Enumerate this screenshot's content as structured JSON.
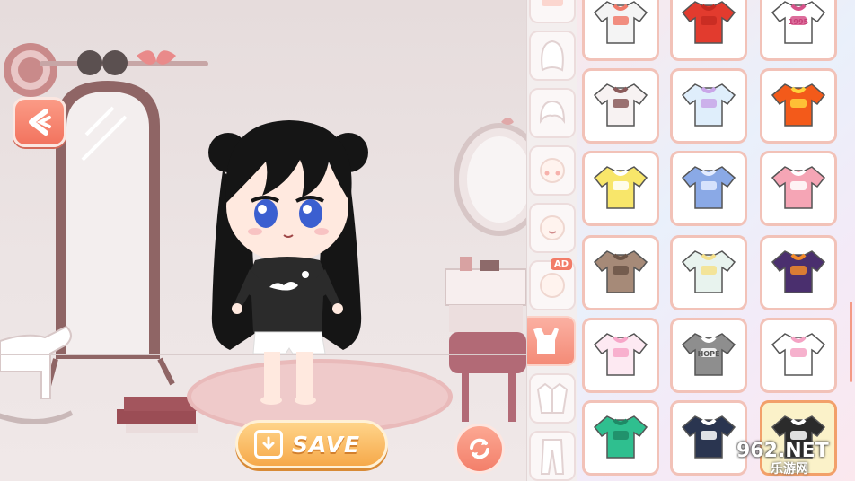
{
  "scene": {
    "save_label": "SAVE",
    "icons": {
      "back": "back-arrow-icon",
      "save": "save-download-icon",
      "refresh": "refresh-icon"
    }
  },
  "categories": [
    {
      "name": "accessory",
      "icon": "box-icon",
      "active": false,
      "ad": ""
    },
    {
      "name": "hair-back",
      "icon": "hair-back-icon",
      "active": false,
      "ad": ""
    },
    {
      "name": "hair-front",
      "icon": "hair-front-icon",
      "active": false,
      "ad": ""
    },
    {
      "name": "face",
      "icon": "face-blush-icon",
      "active": false,
      "ad": ""
    },
    {
      "name": "mouth",
      "icon": "face-mouth-icon",
      "active": false,
      "ad": ""
    },
    {
      "name": "head",
      "icon": "head-icon",
      "active": false,
      "ad": "AD"
    },
    {
      "name": "top",
      "icon": "top-icon",
      "active": true,
      "ad": ""
    },
    {
      "name": "jacket",
      "icon": "jacket-icon",
      "active": false,
      "ad": ""
    },
    {
      "name": "pants",
      "icon": "pants-icon",
      "active": false,
      "ad": ""
    }
  ],
  "items": [
    {
      "icon": "tshirt-flower-icon",
      "color": "#f4f4f4",
      "accent": "#f07a6a",
      "label": "",
      "selected": false
    },
    {
      "icon": "polo-red-icon",
      "color": "#e23b2e",
      "accent": "#c52b21",
      "label": "",
      "selected": false
    },
    {
      "icon": "tshirt-1995-icon",
      "color": "#ffffff",
      "accent": "#d6538a",
      "label": "1995",
      "selected": false
    },
    {
      "icon": "blouse-sailor-icon",
      "color": "#f7f2f2",
      "accent": "#8a5a5a",
      "label": "",
      "selected": false
    },
    {
      "icon": "frilly-dress-icon",
      "color": "#dfeefb",
      "accent": "#c9a6e8",
      "label": "",
      "selected": false
    },
    {
      "icon": "tshirt-orange-icon",
      "color": "#f35a1a",
      "accent": "#ffd23c",
      "label": "",
      "selected": false
    },
    {
      "icon": "top-yellow-icon",
      "color": "#f8e66a",
      "accent": "#ffffff",
      "label": "",
      "selected": false
    },
    {
      "icon": "top-blue-frill-icon",
      "color": "#8aa9e6",
      "accent": "#e3ecff",
      "label": "",
      "selected": false
    },
    {
      "icon": "top-pink-bow-icon",
      "color": "#f5a5b5",
      "accent": "#ffffff",
      "label": "",
      "selected": false
    },
    {
      "icon": "shirt-brown-icon",
      "color": "#a68a78",
      "accent": "#6b5446",
      "label": "",
      "selected": false
    },
    {
      "icon": "jacket-pastel-icon",
      "color": "#e8f3ee",
      "accent": "#f5e08a",
      "label": "",
      "selected": false
    },
    {
      "icon": "jacket-purple-orange-icon",
      "color": "#4a2f6e",
      "accent": "#f28a2a",
      "label": "",
      "selected": false
    },
    {
      "icon": "sweater-rainbow-icon",
      "color": "#fde9f2",
      "accent": "#f7a6c8",
      "label": "",
      "selected": false
    },
    {
      "icon": "sweater-gray-hope-icon",
      "color": "#8e8e8e",
      "accent": "#ffffff",
      "label": "HOPE",
      "selected": false
    },
    {
      "icon": "sweater-white-pink-icon",
      "color": "#ffffff",
      "accent": "#f4a3c4",
      "label": "",
      "selected": false
    },
    {
      "icon": "sweater-green-icon",
      "color": "#2fbf8f",
      "accent": "#1e8a66",
      "label": "",
      "selected": false
    },
    {
      "icon": "vest-navy-icon",
      "color": "#2a3550",
      "accent": "#ffffff",
      "label": "",
      "selected": false
    },
    {
      "icon": "sweater-black-cloud-icon",
      "color": "#2b2b2b",
      "accent": "#ffffff",
      "label": "",
      "selected": true
    }
  ],
  "watermark": {
    "number": "962",
    "suffix": ".NET",
    "sub": "乐游网"
  }
}
